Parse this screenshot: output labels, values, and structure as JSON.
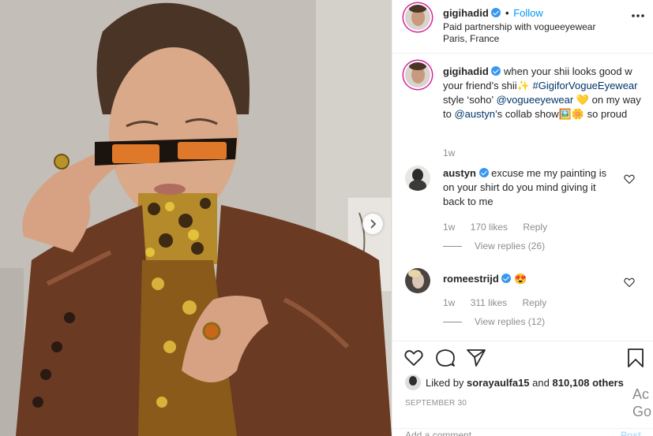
{
  "header": {
    "username": "gigihadid",
    "follow_label": "Follow",
    "dot": "•",
    "partnership": "Paid partnership with vogueeyewear",
    "location": "Paris, France"
  },
  "caption": {
    "username": "gigihadid",
    "text1": "when your shii looks good w your friend’s shii✨",
    "hashtag": "#GigiforVogueEyewear",
    "text2": " style ‘soho’",
    "mention1": "@vogueeyewear",
    "text3": " 💛 on my way to",
    "mention2": "@austyn",
    "text4": "’s collab show🖼️🌼 so proud",
    "time": "1w"
  },
  "comments": [
    {
      "username": "austyn",
      "text": "excuse me my painting is on your shirt do you mind giving it back to me",
      "time": "1w",
      "likes": "170 likes",
      "reply": "Reply",
      "view_replies": "View replies (26)"
    },
    {
      "username": "romeestrijd",
      "text": "😍",
      "time": "1w",
      "likes": "311 likes",
      "reply": "Reply",
      "view_replies": "View replies (12)"
    }
  ],
  "actions": {
    "liked_prefix": "Liked by",
    "liked_user": "sorayaulfa15",
    "liked_and": "and",
    "liked_count": "810,108 others",
    "date": "SEPTEMBER 30",
    "add_comment_placeholder": "Add a comment...",
    "post_label": "Post"
  },
  "overlay": {
    "activate_line1": "Ac",
    "activate_line2": "Go"
  },
  "colors": {
    "link": "#003569",
    "follow": "#0095f6",
    "verified": "#3897f0",
    "secondary_text": "#8e8e8e"
  },
  "icons": [
    "more-options-icon",
    "verified-badge-icon",
    "heart-icon",
    "comment-icon",
    "share-icon",
    "bookmark-icon",
    "chevron-right-icon"
  ]
}
